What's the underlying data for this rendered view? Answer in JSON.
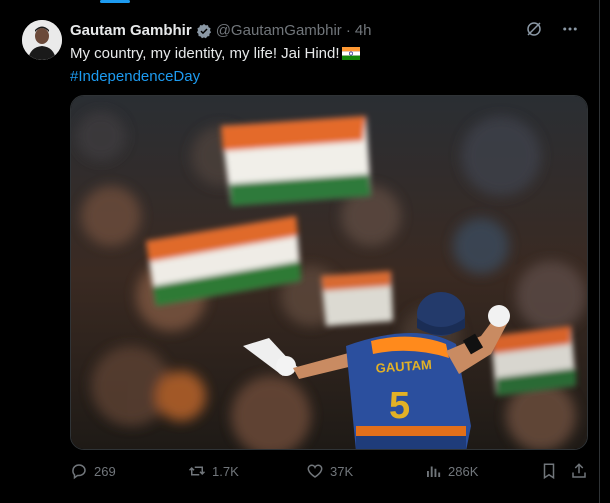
{
  "tweet": {
    "display_name": "Gautam Gambhir",
    "handle": "@GautamGambhir",
    "separator": "·",
    "time": "4h",
    "text": "My country, my identity, my life! Jai Hind!",
    "hashtag": "#IndependenceDay"
  },
  "media": {
    "jersey_name": "GAUTAM",
    "jersey_number": "5"
  },
  "actions": {
    "replies": "269",
    "reposts": "1.7K",
    "likes": "37K",
    "views": "286K"
  },
  "colors": {
    "accent": "#1d9bf0",
    "muted": "#71767b",
    "text": "#e7e9ea"
  }
}
